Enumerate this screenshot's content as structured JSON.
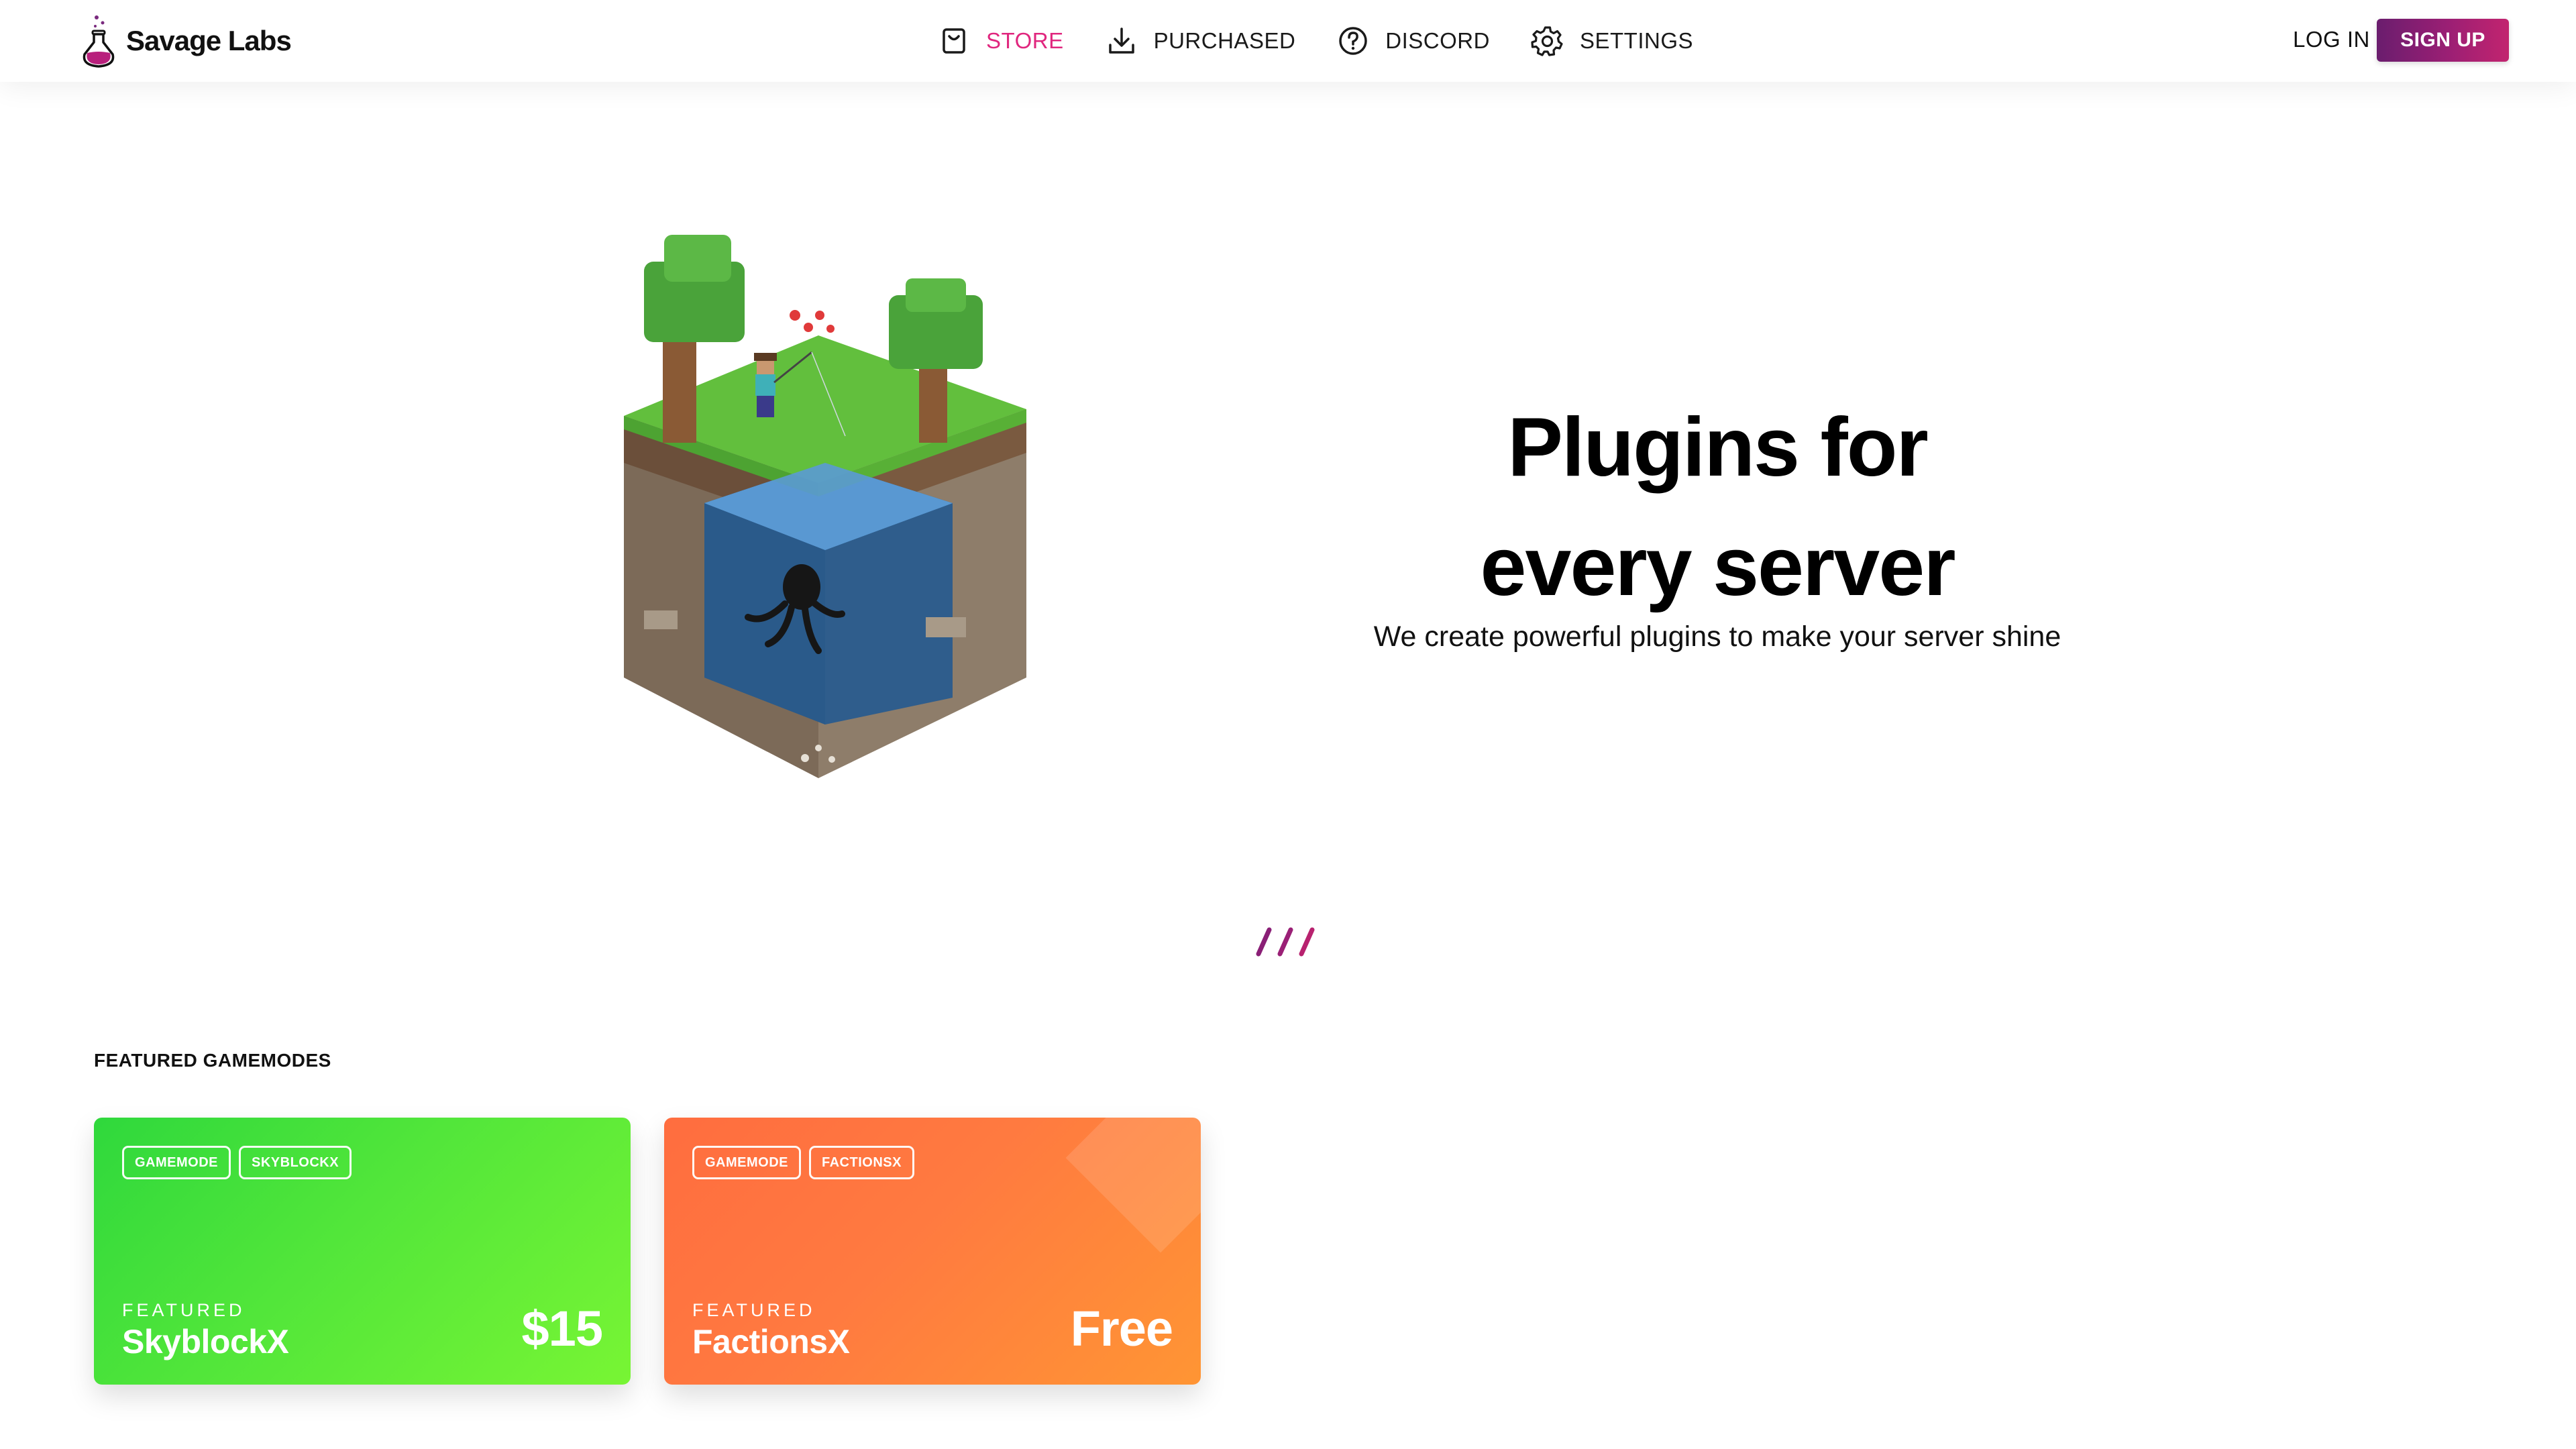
{
  "brand": {
    "name": "Savage Labs"
  },
  "nav": [
    {
      "label": "STORE",
      "icon": "shopping-bag-icon",
      "active": true
    },
    {
      "label": "PURCHASED",
      "icon": "download-icon",
      "active": false
    },
    {
      "label": "DISCORD",
      "icon": "help-circle-icon",
      "active": false
    },
    {
      "label": "SETTINGS",
      "icon": "gear-icon",
      "active": false
    }
  ],
  "auth": {
    "login_label": "LOG IN",
    "signup_label": "SIGN UP"
  },
  "hero": {
    "title_line1": "Plugins for",
    "title_line2": "every server",
    "subtitle": "We create powerful plugins to make your server shine"
  },
  "featured": {
    "title": "FEATURED GAMEMODES",
    "cards": [
      {
        "tags": [
          "GAMEMODE",
          "SKYBLOCKX"
        ],
        "eyebrow": "FEATURED",
        "name": "SkyblockX",
        "price": "$15",
        "color": "#3ddc3a"
      },
      {
        "tags": [
          "GAMEMODE",
          "FACTIONSX"
        ],
        "eyebrow": "FEATURED",
        "name": "FactionsX",
        "price": "Free",
        "color": "#ff7a45"
      }
    ]
  },
  "colors": {
    "accent": "#e0267e",
    "signup_gradient_start": "#6a1d6e",
    "signup_gradient_end": "#c2246f"
  }
}
